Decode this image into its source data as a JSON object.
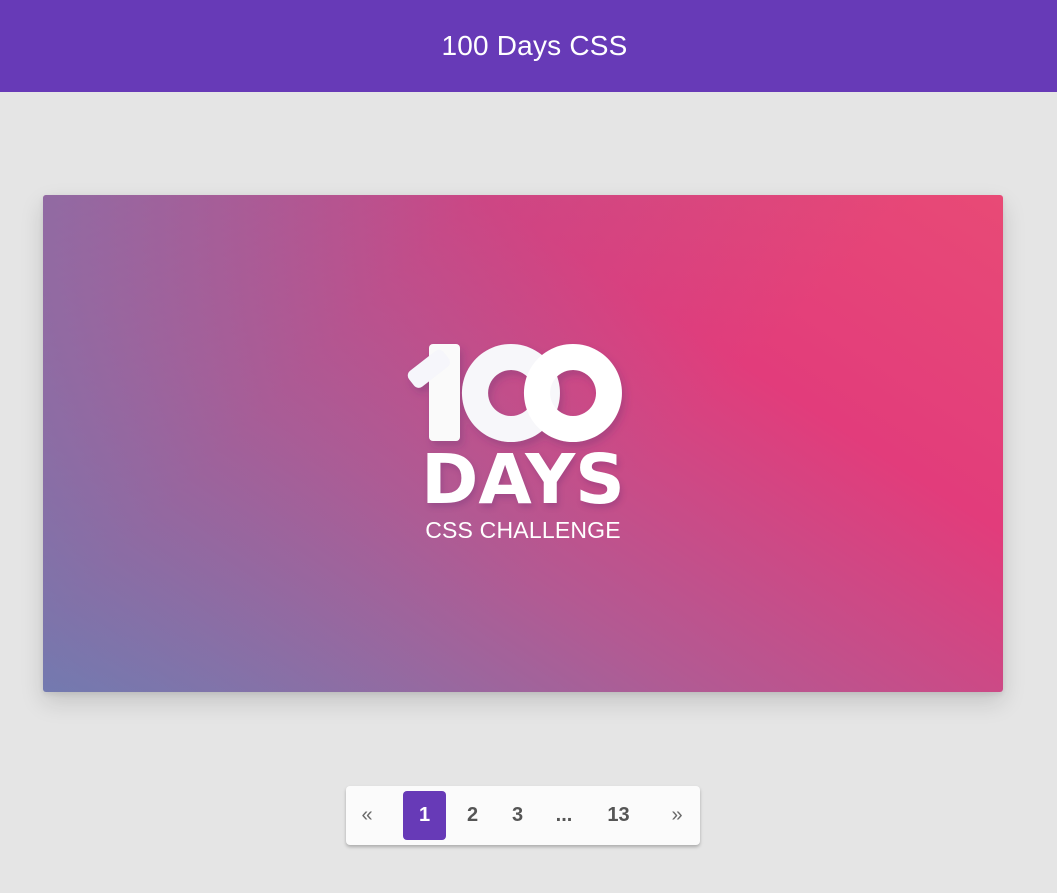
{
  "header": {
    "title": "100 Days CSS",
    "background": "#673ab7"
  },
  "hero": {
    "logo_number": "100",
    "logo_word": "DAYS",
    "logo_subtitle": "CSS CHALLENGE",
    "gradient_colors": [
      "#6c80b4",
      "#b25a93",
      "#e23c7b",
      "#e84a76"
    ]
  },
  "pagination": {
    "prev_label": "«",
    "next_label": "»",
    "pages": [
      "1",
      "2",
      "3",
      "...",
      "13"
    ],
    "current_page": "1",
    "accent": "#673ab7"
  }
}
